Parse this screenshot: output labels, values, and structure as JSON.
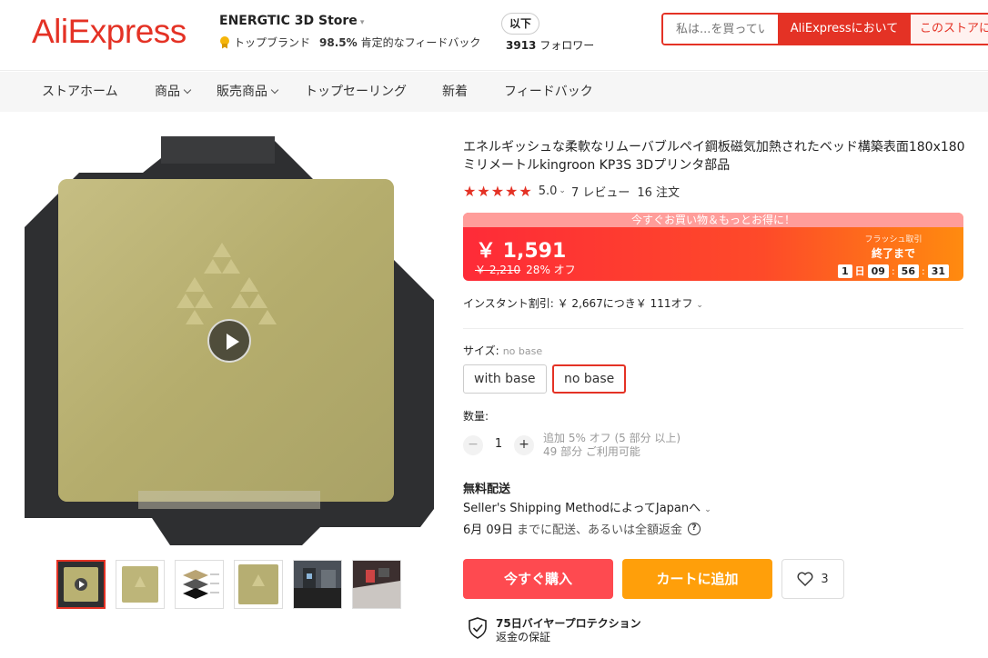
{
  "header": {
    "logo": "AliExpress",
    "store_name": "ENERGTIC 3D Store",
    "store_caret": "▾",
    "top_brand": "トップブランド",
    "feedback_pct": "98.5%",
    "feedback_label": "肯定的なフィードバック",
    "follow_button": "以下",
    "followers_count": "3913",
    "followers_label": "フォロワー",
    "search": {
      "placeholder": "私は...を買ってい",
      "in_aliexpress": "AliExpressにおいて",
      "in_store": "このストアに"
    }
  },
  "nav": {
    "items": [
      {
        "label": "ストアホーム",
        "has_dropdown": false
      },
      {
        "label": "商品",
        "has_dropdown": true
      },
      {
        "label": "販売商品",
        "has_dropdown": true
      },
      {
        "label": "トップセーリング",
        "has_dropdown": false
      },
      {
        "label": "新着",
        "has_dropdown": false
      },
      {
        "label": "フィードバック",
        "has_dropdown": false
      }
    ]
  },
  "product": {
    "title": "エネルギッシュな柔軟なリムーバブルペイ鋼板磁気加熱されたベッド構築表面180x180ミリメートルkingroon KP3S 3Dプリンタ部品",
    "rating": "5.0",
    "rating_chev": "⌄",
    "reviews": "7 レビュー",
    "orders": "16 注文",
    "price_banner": "今すぐお買い物＆もっとお得に！",
    "price": "￥ 1,591",
    "original_price": "￥ 2,210",
    "discount": "28% オフ",
    "flash_title": "フラッシュ取引",
    "flash_end": "終了まで",
    "timer": {
      "days": "1",
      "day_label": "日",
      "hours": "09",
      "minutes": "56",
      "seconds": "31"
    },
    "instant_discount": "インスタント割引: ￥ 2,667につき￥ 111オフ",
    "size_label": "サイズ:",
    "size_selected": "no base",
    "size_options": [
      "with base",
      "no base"
    ],
    "quantity_label": "数量:",
    "quantity": "1",
    "qty_minus": "−",
    "qty_plus": "+",
    "qty_note_1": "追加 5% オフ (5 部分 以上)",
    "qty_note_2": "49 部分 ご利用可能",
    "shipping_title": "無料配送",
    "shipping_method": "Seller's Shipping MethodによってJapanへ",
    "delivery_date": "6月 09日",
    "delivery_note": "までに配送、あるいは全額返金",
    "buy_now": "今すぐ購入",
    "add_to_cart": "カートに追加",
    "wishlist_count": "3",
    "protection_title": "75日バイヤープロテクション",
    "protection_sub": "返金の保証"
  },
  "colors": {
    "brand_red": "#e43225",
    "buy_red": "#fe4a50",
    "cart_orange": "#ff9f0a",
    "price_gradient_start": "#fe2b38",
    "price_gradient_end": "#ff8b0f"
  }
}
